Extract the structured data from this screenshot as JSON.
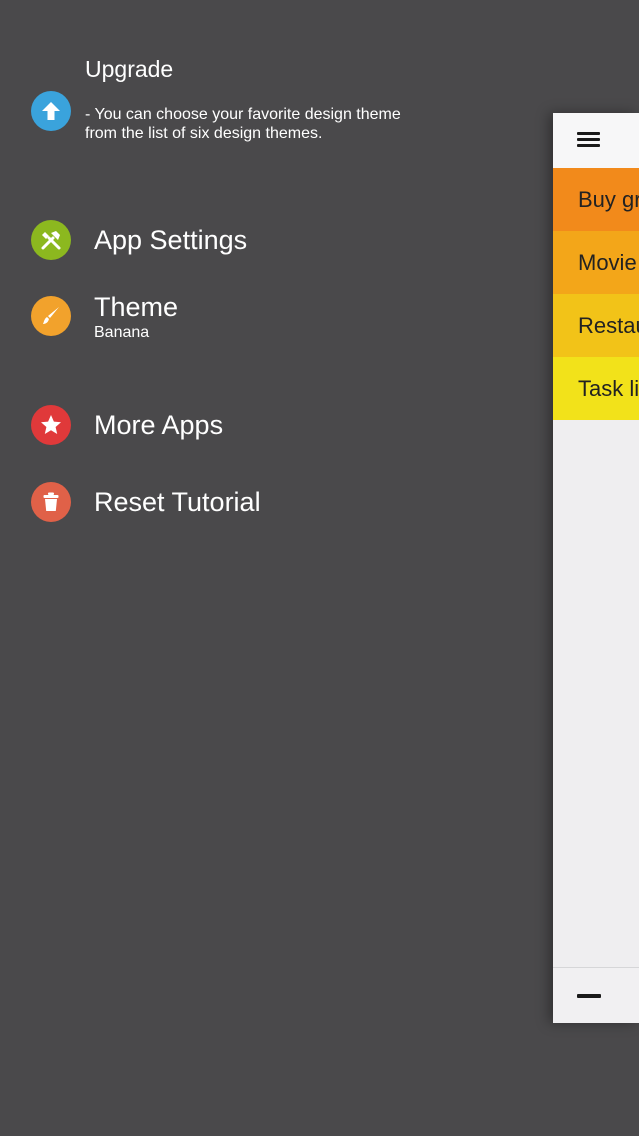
{
  "menu": {
    "upgrade": {
      "title": "Upgrade",
      "description": "- You can choose your favorite design theme from the list of six design themes.",
      "icon": "arrow-up-icon",
      "color": "#3aa3dc"
    },
    "app_settings": {
      "label": "App Settings",
      "icon": "tools-icon",
      "color": "#8cb81f"
    },
    "theme": {
      "label": "Theme",
      "value": "Banana",
      "icon": "paintbrush-icon",
      "color": "#f2a22c"
    },
    "more_apps": {
      "label": "More Apps",
      "icon": "star-icon",
      "color": "#e0393a"
    },
    "reset_tutorial": {
      "label": "Reset Tutorial",
      "icon": "trash-icon",
      "color": "#e06148"
    }
  },
  "panel": {
    "rows": [
      {
        "label": "Buy gr",
        "color": "#f28a1b"
      },
      {
        "label": "Movie",
        "color": "#f3a619"
      },
      {
        "label": "Restau",
        "color": "#f2c318"
      },
      {
        "label": "Task li",
        "color": "#f2e21a"
      }
    ]
  }
}
